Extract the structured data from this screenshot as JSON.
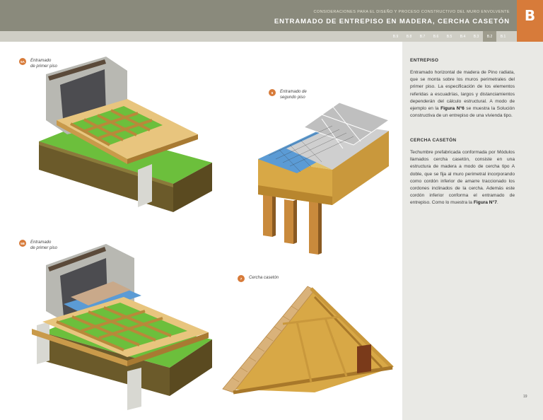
{
  "header": {
    "supertitle": "CONSIDERACIONES PARA EL DISEÑO Y PROCESO CONSTRUCTIVO DEL MURO ENVOLVENTE",
    "title": "ENTRAMADO DE ENTREPISO EN MADERA, CERCHA CASETÓN",
    "badge": "B"
  },
  "nav": {
    "tabs": [
      "B.9",
      "B.8",
      "B.7",
      "B.6",
      "B.5",
      "B.4",
      "B.3",
      "B.2",
      "B.1"
    ],
    "active": "B.2"
  },
  "figures": {
    "f5a": {
      "num": "5A",
      "caption_l1": "Entramado",
      "caption_l2": "de primer piso"
    },
    "f6": {
      "num": "6",
      "caption_l1": "Entramado de",
      "caption_l2": "segundo piso"
    },
    "f5b": {
      "num": "5B",
      "caption_l1": "Entramado",
      "caption_l2": "de primer piso"
    },
    "f7": {
      "num": "7",
      "caption_l1": "Cercha casetón"
    }
  },
  "sidebar": {
    "entrepiso_title": "ENTREPISO",
    "entrepiso_p1": "Entramado horizontal de madera de Pino radiata, que se monta sobre los muros perimetrales del primer piso. La especificación de los elementos referidas a escuadrías, largos y distanciamientos dependerán del cálculo estructural. A modo de ejemplo en la",
    "entrepiso_fig": "Figura N°6",
    "entrepiso_p2": "se muestra la Solución constructiva de un entrepiso de una vivienda tipo.",
    "cercha_title": "CERCHA CASETÓN",
    "cercha_p1": "Techumbre prefabricada conformada por Módulos llamados cercha casetón, consiste en una estructura de madera a modo de cercha tipo A doble, que se fija al muro perimetral incorporando como cordón inferior de amarre traccionado los cordones inclinados de la cercha. Además este cordón inferior conforma el entramado de entrepiso. Como lo muestra la",
    "cercha_fig": "Figura N°7",
    "cercha_p2": "."
  },
  "page_number": "19",
  "colors": {
    "header_bg": "#8a8a7c",
    "badge_bg": "#d77b3a",
    "sidebar_bg": "#e9e9e5",
    "wood": "#e8c57e",
    "grass": "#6cbf3c",
    "soil": "#6b5a2a"
  }
}
